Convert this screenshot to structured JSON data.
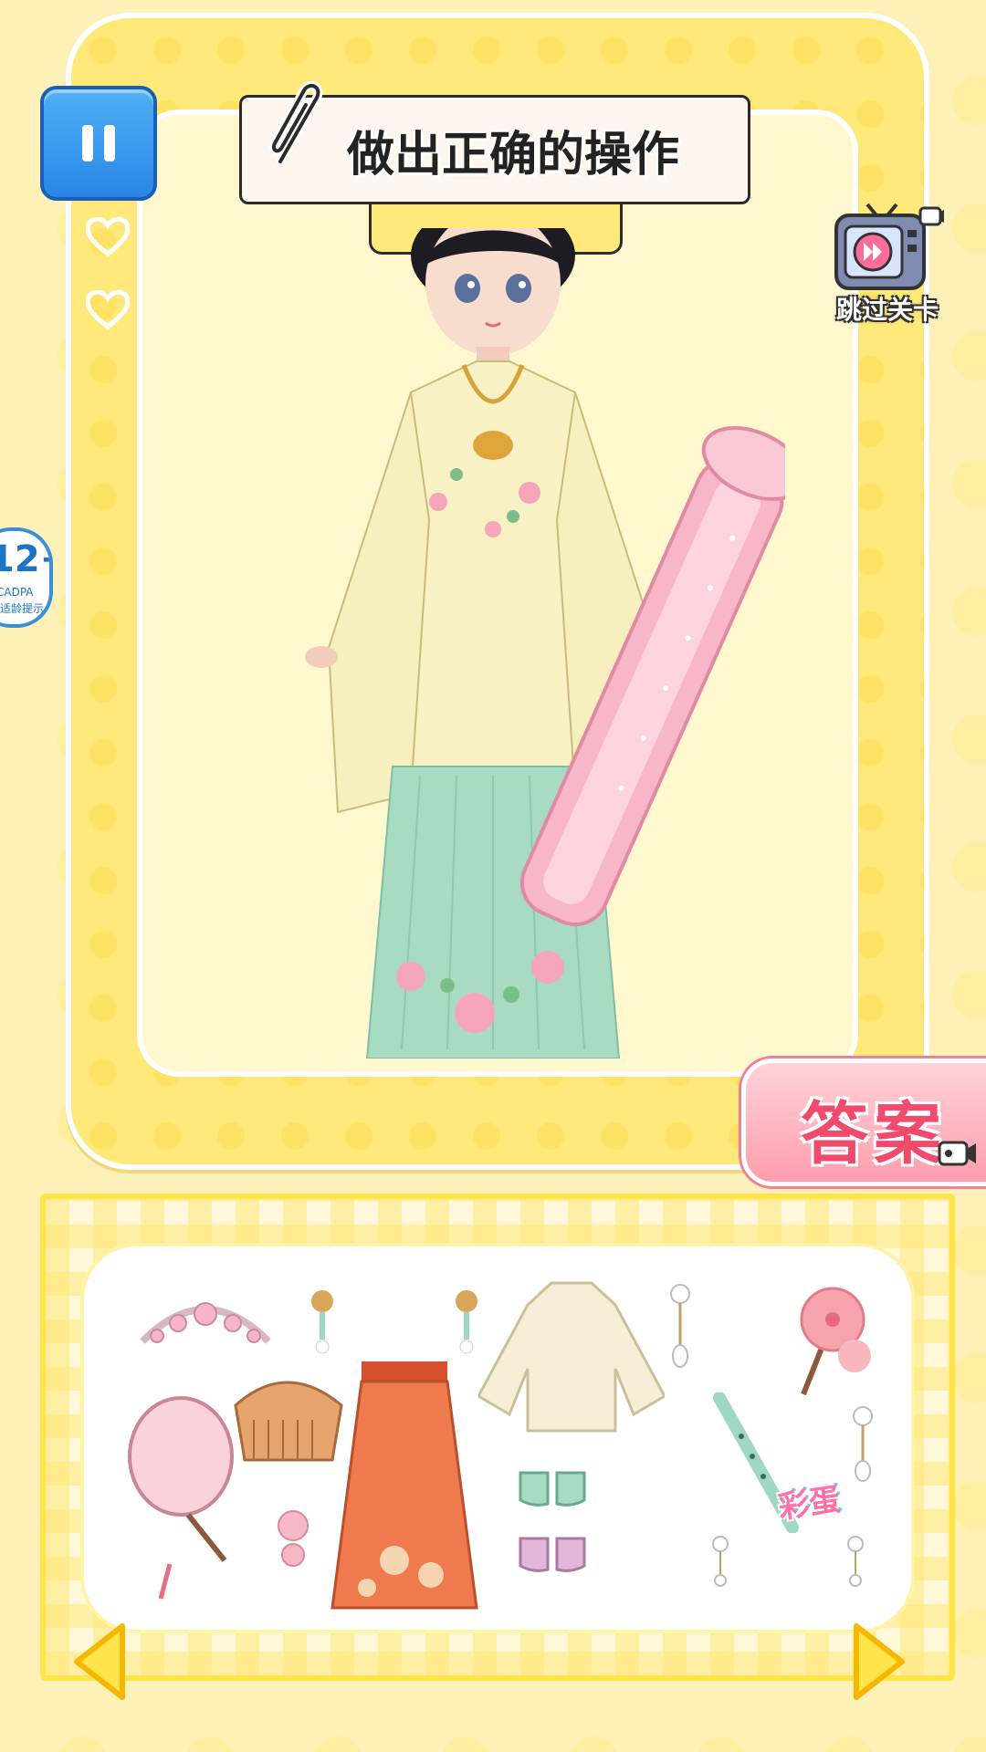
{
  "banner": {
    "title": "做出正确的操作"
  },
  "skip_level": {
    "label": "跳过关卡"
  },
  "age_rating": {
    "number": "12+",
    "org": "CADPA",
    "tip": "适龄提示"
  },
  "answer_button": {
    "label": "答案"
  },
  "lives": {
    "count": 2
  },
  "wardrobe": {
    "items": [
      "tiara",
      "hairpin-left",
      "hairpin-middle",
      "ruqun-jacket",
      "earring-top",
      "peach-blossom",
      "round-fan",
      "wooden-comb",
      "orange-mamianqun-skirt",
      "green-shoes",
      "pink-shoes",
      "flower-pendant",
      "small-pendant-left",
      "flute",
      "small-pendant-right",
      "earring-right"
    ],
    "bonus_label": "彩蛋"
  },
  "colors": {
    "accent": "#ffe34a",
    "answer": "#f04a6c",
    "pause": "#2a86e6"
  }
}
